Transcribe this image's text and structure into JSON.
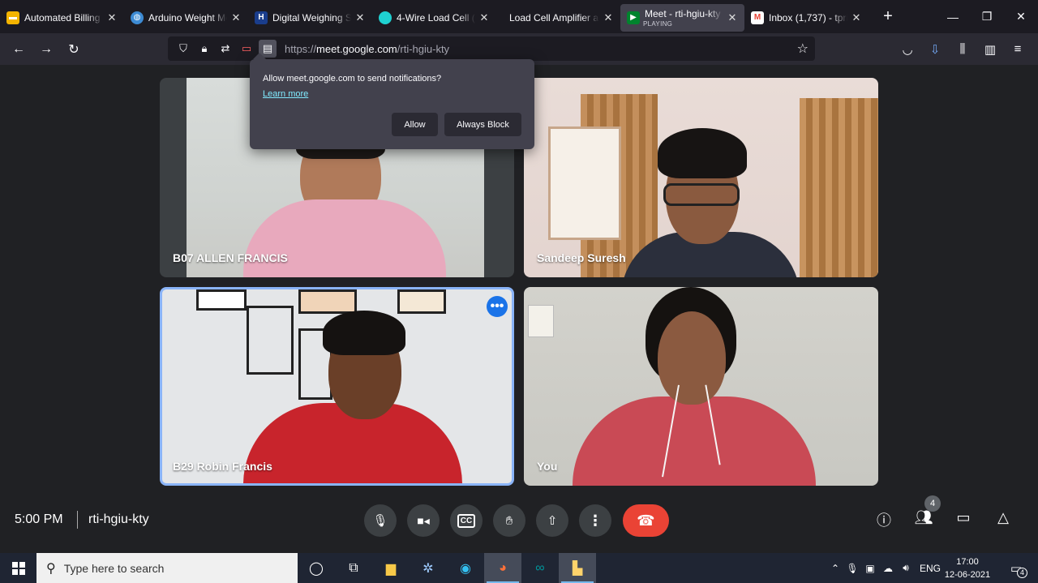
{
  "tabs": [
    {
      "title": "Automated Billing S",
      "favicon": "slides-icon",
      "color": "#f4b400",
      "glyph": "▬"
    },
    {
      "title": "Arduino Weight Me",
      "favicon": "globe-icon",
      "color": "#3d8bd4",
      "glyph": "◍"
    },
    {
      "title": "Digital Weighing Sc",
      "favicon": "h-logo-icon",
      "color": "#1a3d8c",
      "glyph": "H"
    },
    {
      "title": "4-Wire Load Cell (1/",
      "favicon": "circle-logo-icon",
      "color": "#1fd1d1",
      "glyph": ""
    },
    {
      "title": "Load Cell Amplifier and",
      "favicon": "",
      "color": "",
      "glyph": ""
    },
    {
      "title": "Meet - rti-hgiu-kty",
      "subtitle": "PLAYING",
      "favicon": "meet-icon",
      "color": "#00832d",
      "glyph": "▶"
    },
    {
      "title": "Inbox (1,737) - tpriy",
      "favicon": "gmail-icon",
      "color": "#ea4335",
      "glyph": "M"
    }
  ],
  "url": {
    "prefix": "https://",
    "host": "meet.google.com",
    "path": "/rti-hgiu-kty"
  },
  "popup": {
    "message": "Allow meet.google.com to send notifications?",
    "learn_more": "Learn more",
    "allow": "Allow",
    "block": "Always Block"
  },
  "participants": [
    {
      "name": "B07 ALLEN FRANCIS"
    },
    {
      "name": "Sandeep Suresh"
    },
    {
      "name": "B29 Robin Francis"
    },
    {
      "name": "You"
    }
  ],
  "meeting": {
    "time": "5:00 PM",
    "code": "rti-hgiu-kty",
    "people_count": "4"
  },
  "taskbar": {
    "search_placeholder": "Type here to search",
    "lang": "ENG",
    "time": "17:00",
    "date": "12-06-2021",
    "notifications": "4"
  },
  "colors": {
    "accent": "#8ab4f8",
    "end_call": "#ea4335",
    "link": "#80ebff"
  }
}
